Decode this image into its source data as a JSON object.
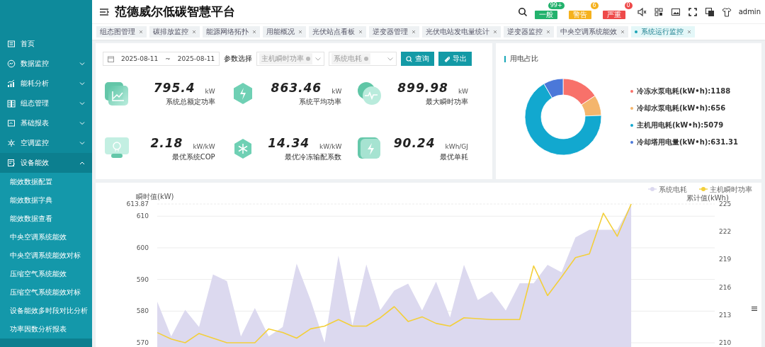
{
  "header": {
    "title": "范德威尔低碳智慧平台",
    "alerts": [
      {
        "label": "一般",
        "count": "99+",
        "color": "#23b26d"
      },
      {
        "label": "警告",
        "count": "6",
        "color": "#f5b11d"
      },
      {
        "label": "严重",
        "count": "0",
        "color": "#ee4a4a"
      }
    ],
    "user": "admin"
  },
  "sidebar": {
    "items": [
      {
        "label": "首页",
        "kind": "link"
      },
      {
        "label": "数据监控",
        "kind": "group",
        "expanded": false
      },
      {
        "label": "能耗分析",
        "kind": "group",
        "expanded": false
      },
      {
        "label": "组态管理",
        "kind": "group",
        "expanded": false
      },
      {
        "label": "基础报表",
        "kind": "group",
        "expanded": false
      },
      {
        "label": "空调监控",
        "kind": "group",
        "expanded": false
      },
      {
        "label": "设备能效",
        "kind": "group",
        "expanded": true,
        "children": [
          "能效数据配置",
          "能效数据字典",
          "能效数据查看",
          "中央空调系统能效",
          "中央空调系统能效对标",
          "压缩空气系统能效",
          "压缩空气系统能效对标",
          "设备能效多时段对比分析",
          "功率因数分析报表"
        ]
      }
    ]
  },
  "tabs": [
    {
      "label": "组态图管理",
      "selected": false
    },
    {
      "label": "碳排放监控",
      "selected": false
    },
    {
      "label": "能源网络拓扑",
      "selected": false
    },
    {
      "label": "用能概况",
      "selected": false
    },
    {
      "label": "光伏站点看板",
      "selected": false
    },
    {
      "label": "逆变器管理",
      "selected": false
    },
    {
      "label": "光伏电站发电量统计",
      "selected": false
    },
    {
      "label": "逆变器监控",
      "selected": false
    },
    {
      "label": "中央空调系统能效",
      "selected": false
    },
    {
      "label": "系统运行监控",
      "selected": true
    }
  ],
  "filters": {
    "start_date": "2025-08-11",
    "separator": "~",
    "end_date": "2025-08-11",
    "param_label": "参数选择",
    "select_1": "主机瞬时功率",
    "select_2": "系统电耗",
    "buttons": [
      "查询",
      "导出"
    ]
  },
  "kpis": [
    {
      "value": "795.4",
      "unit": "kW",
      "label": "系统总额定功率"
    },
    {
      "value": "863.46",
      "unit": "kW",
      "label": "系统平均功率"
    },
    {
      "value": "899.98",
      "unit": "kW",
      "label": "最大瞬时功率"
    },
    {
      "value": "2.18",
      "unit": "kW/kW",
      "label": "最优系统COP"
    },
    {
      "value": "14.34",
      "unit": "kW/kW",
      "label": "最优冷冻输配系数"
    },
    {
      "value": "90.24",
      "unit": "kWh/GJ",
      "label": "最优单耗"
    }
  ],
  "usage": {
    "title": "用电占比",
    "chart_data": {
      "type": "donut",
      "legend": "right",
      "categories": [
        "冷冻水泵电耗(kW•h):1188",
        "冷却水泵电耗(kW•h):656",
        "主机用电耗(kW•h):5079",
        "冷却塔用电量(kW•h):631.31"
      ],
      "values": [
        1188,
        656,
        5079,
        631.31
      ],
      "colors": [
        "#f8716a",
        "#f4b56c",
        "#12a8cf",
        "#4b78d9"
      ]
    }
  },
  "trend": {
    "chart_data": {
      "type": "line",
      "legend": "top",
      "grid": true,
      "ylabel": "瞬时值(kW)",
      "y2label": "累计值(kWh)",
      "ylim": [
        570,
        613.87
      ],
      "yticks": [
        570,
        580,
        590,
        600,
        610,
        {
          "value": 613.87,
          "label": "613.87"
        }
      ],
      "y2lim": [
        210,
        225
      ],
      "y2ticks": [
        210,
        213,
        216,
        219,
        222,
        225
      ],
      "series": [
        {
          "name": "系统电耗",
          "color": "#dcd9ef",
          "type": "area",
          "values": [
            583,
            572,
            580.4,
            575,
            591.6,
            589.5,
            572,
            581,
            572,
            575,
            595,
            583.5,
            570,
            597.5,
            575.5,
            594.7,
            580.3,
            586.5,
            588.7,
            580.2,
            589.3,
            578,
            594.6,
            583.5,
            586.2,
            580.2,
            588.8,
            588.8,
            594.6,
            592.3,
            603.3,
            605.7,
            605.7,
            605.7,
            613.87
          ]
        },
        {
          "name": "主机瞬时功率",
          "color": "#f3cf3a",
          "axis": "y2",
          "values": [
            211.1,
            210.4,
            210,
            211,
            210.5,
            210,
            210,
            210,
            211.5,
            211.1,
            210.5,
            211.5,
            211.8,
            212.5,
            211.8,
            211.8,
            212.7,
            213.9,
            212.3,
            212.8,
            212.1,
            211.8,
            212.7,
            212.6,
            212.5,
            212.5,
            212.5,
            218.3,
            215.1,
            217.1,
            219.2,
            219.6,
            224,
            221.5,
            225
          ]
        }
      ]
    }
  }
}
